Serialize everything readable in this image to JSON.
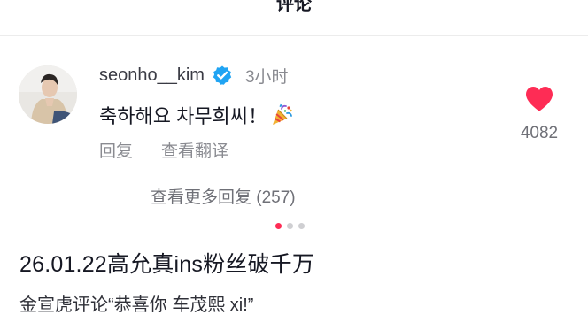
{
  "header": {
    "title": "评论"
  },
  "comment": {
    "username": "seonho__kim",
    "time": "3小时",
    "text": "축하해요 차무희씨！",
    "actions": {
      "reply": "回复",
      "translate": "查看翻译"
    },
    "likes": "4082",
    "view_replies": "查看更多回复 (257)"
  },
  "pager": {
    "count": 3,
    "active_index": 0
  },
  "post": {
    "title": "26.01.22高允真ins粉丝破千万",
    "subtitle": "金宣虎评论“恭喜你 车茂熙 xi!”"
  },
  "colors": {
    "accent": "#fe2c55",
    "verified": "#20d5ec",
    "text_primary": "#161823",
    "text_secondary": "#8a8b91"
  },
  "icons": {
    "verified": "verified-badge-icon",
    "like": "heart-icon",
    "emoji": "party-popper-icon"
  }
}
